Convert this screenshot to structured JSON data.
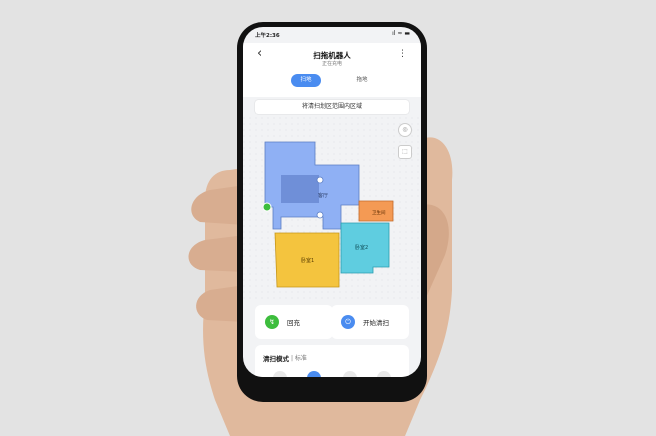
{
  "status_bar": {
    "time": "上午2:36",
    "icons": "ıl ≈ ▬"
  },
  "header": {
    "back_glyph": "‹",
    "title": "扫拖机器人",
    "subtitle": "正在充电",
    "more_glyph": "⋮"
  },
  "tabs": [
    {
      "label": "扫地",
      "active": true
    },
    {
      "label": "拖地",
      "active": false
    }
  ],
  "banner": {
    "text": "将清扫划区范围内区域"
  },
  "map": {
    "rooms": [
      {
        "label": "客厅",
        "color": "#8fb0f4"
      },
      {
        "label": "卧室1",
        "color": "#f4c43e"
      },
      {
        "label": "卧室2",
        "color": "#5fcde0"
      },
      {
        "label": "卫生间",
        "color": "#f49a54"
      }
    ],
    "buttons": [
      {
        "icon": "map-pin-icon"
      },
      {
        "icon": "area-select-icon"
      }
    ]
  },
  "actions": [
    {
      "label": "回充",
      "icon": "recharge-icon",
      "color": "#3dbd3d",
      "glyph": "↯"
    },
    {
      "label": "开始清扫",
      "icon": "power-icon",
      "color": "#4a8cf0",
      "glyph": "⏻"
    }
  ],
  "mode": {
    "label": "清扫模式",
    "value": "| 标准"
  }
}
